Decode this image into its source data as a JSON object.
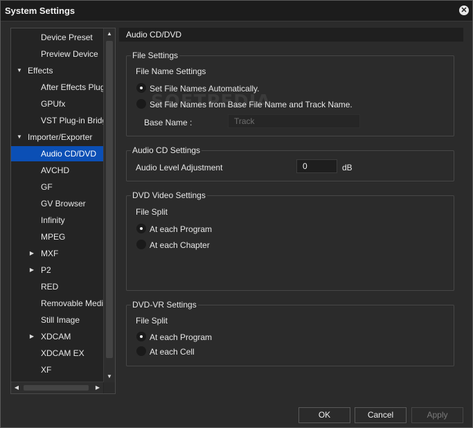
{
  "window": {
    "title": "System Settings",
    "close_glyph": "✕"
  },
  "tree": {
    "items": [
      {
        "label": "Device Preset",
        "caret": ""
      },
      {
        "label": "Preview Device",
        "caret": ""
      },
      {
        "label": "Effects",
        "caret": "▼"
      },
      {
        "label": "After Effects Plug-",
        "caret": ""
      },
      {
        "label": "GPUfx",
        "caret": ""
      },
      {
        "label": "VST Plug-in Bridge",
        "caret": ""
      },
      {
        "label": "Importer/Exporter",
        "caret": "▼"
      },
      {
        "label": "Audio CD/DVD",
        "caret": "",
        "selected": true
      },
      {
        "label": "AVCHD",
        "caret": ""
      },
      {
        "label": "GF",
        "caret": ""
      },
      {
        "label": "GV Browser",
        "caret": ""
      },
      {
        "label": "Infinity",
        "caret": ""
      },
      {
        "label": "MPEG",
        "caret": ""
      },
      {
        "label": "MXF",
        "caret": "▶"
      },
      {
        "label": "P2",
        "caret": "▶"
      },
      {
        "label": "RED",
        "caret": ""
      },
      {
        "label": "Removable Media",
        "caret": ""
      },
      {
        "label": "Still Image",
        "caret": ""
      },
      {
        "label": "XDCAM",
        "caret": "▶"
      },
      {
        "label": "XDCAM EX",
        "caret": ""
      },
      {
        "label": "XF",
        "caret": ""
      }
    ],
    "scroll_up": "▲",
    "scroll_down": "▼",
    "scroll_left": "◀",
    "scroll_right": "▶"
  },
  "panel": {
    "title": "Audio CD/DVD",
    "file_settings": {
      "title": "File Settings",
      "subheading": "File Name Settings",
      "option_auto": "Set File Names Automatically.",
      "option_base": "Set File Names from Base File Name and Track Name.",
      "selected": "auto",
      "base_name_label": "Base Name :",
      "base_name_value": "Track"
    },
    "audio_cd": {
      "title": "Audio CD Settings",
      "level_label": "Audio Level Adjustment",
      "level_value": "0",
      "level_unit": "dB"
    },
    "dvd_video": {
      "title": "DVD Video Settings",
      "subheading": "File Split",
      "option_program": "At each Program",
      "option_chapter": "At each Chapter",
      "selected": "program"
    },
    "dvd_vr": {
      "title": "DVD-VR Settings",
      "subheading": "File Split",
      "option_program": "At each Program",
      "option_cell": "At each Cell",
      "selected": "program"
    }
  },
  "watermark": "SOFTPEDIA",
  "buttons": {
    "ok": "OK",
    "cancel": "Cancel",
    "apply": "Apply"
  }
}
